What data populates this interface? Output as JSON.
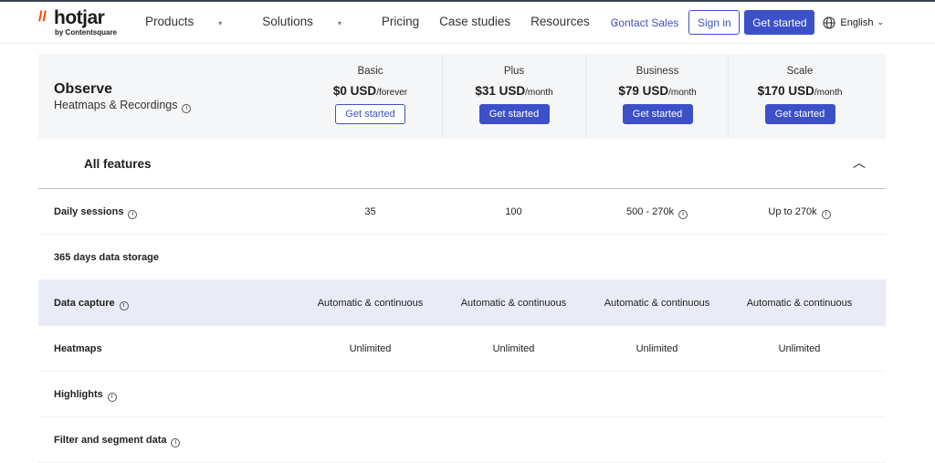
{
  "nav": {
    "logo": "hotjar",
    "logo_sub": "by Contentsquare",
    "menu": [
      "Products",
      "Solutions",
      "Pricing",
      "Case studies",
      "Resources"
    ],
    "contact": "Contact Sales",
    "signin": "Sign in",
    "cta": "Get started",
    "lang": "English"
  },
  "header": {
    "title": "Observe",
    "subtitle": "Heatmaps & Recordings",
    "plans": [
      {
        "name": "Basic",
        "price": "$0 USD",
        "period": "/forever",
        "button": "Get started"
      },
      {
        "name": "Plus",
        "price": "$31 USD",
        "period": "/month",
        "button": "Get started"
      },
      {
        "name": "Business",
        "price": "$79 USD",
        "period": "/month",
        "button": "Get started"
      },
      {
        "name": "Scale",
        "price": "$170 USD",
        "period": "/month",
        "button": "Get started"
      }
    ]
  },
  "all_features": "All features",
  "rows": [
    {
      "label": "Daily sessions",
      "values": [
        "35",
        "100",
        "500 - 270k",
        "Up to 270k"
      ]
    },
    {
      "label": "365 days data storage",
      "values": [
        "",
        "",
        "",
        ""
      ]
    },
    {
      "label": "Data capture",
      "values": [
        "Automatic & continuous",
        "Automatic & continuous",
        "Automatic & continuous",
        "Automatic & continuous"
      ]
    },
    {
      "label": "Heatmaps",
      "values": [
        "Unlimited",
        "Unlimited",
        "Unlimited",
        "Unlimited"
      ]
    },
    {
      "label": "Highlights",
      "values": [
        "",
        "",
        "",
        ""
      ]
    },
    {
      "label": "Filter and segment data",
      "values": [
        "",
        "",
        "",
        ""
      ]
    }
  ]
}
